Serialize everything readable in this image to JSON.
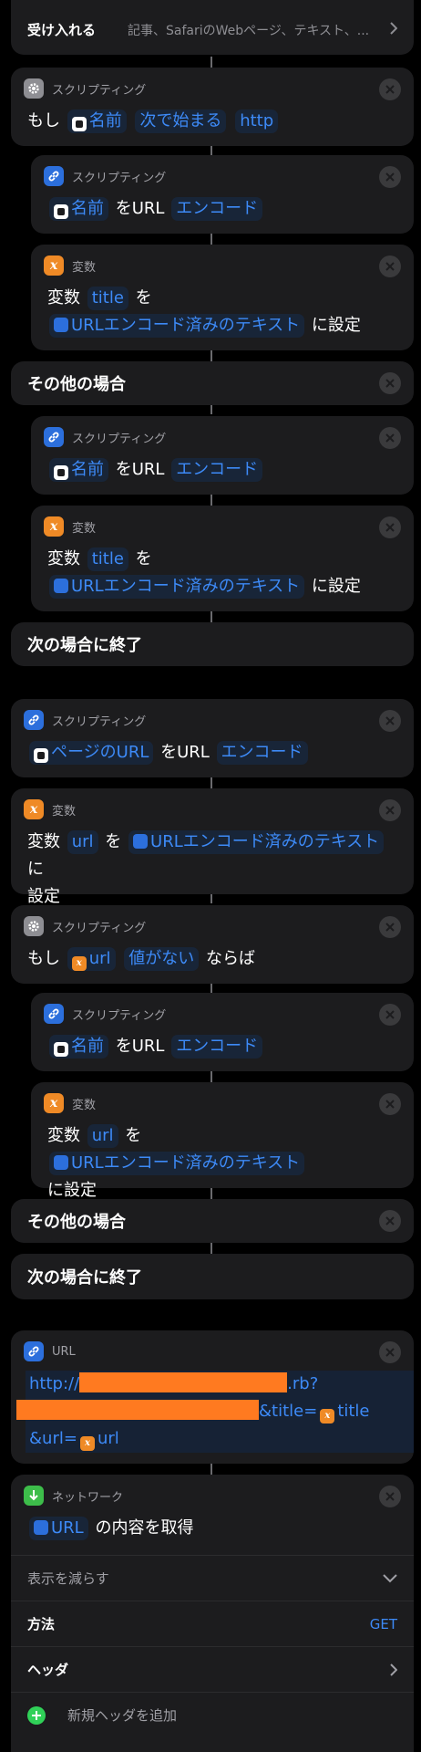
{
  "accept": {
    "label": "受け入れる",
    "value": "記事、SafariのWebページ、テキスト、..."
  },
  "cat_script": "スクリプティング",
  "cat_var": "変数",
  "cat_url": "URL",
  "cat_network": "ネットワーク",
  "if1": {
    "if": "もし",
    "name": "名前",
    "cond": "次で始まる",
    "value": "http"
  },
  "encode": {
    "text": "をURL",
    "mode": "エンコード"
  },
  "setvar": {
    "pre": "変数",
    "wo": "を",
    "encoded": "URLエンコード済みのテキスト",
    "set": "に設定",
    "ni": "に",
    "settei": "設定"
  },
  "var_title": "title",
  "var_url": "url",
  "otherwise": "その他の場合",
  "endif": "次の場合に終了",
  "page_url": "ページのURL",
  "if2": {
    "if": "もし",
    "cond": "値がない",
    "then": "ならば"
  },
  "url_block": {
    "prefix": "http://",
    "mid": ".rb?",
    "title_param": "&title=",
    "url_param": "&url="
  },
  "network": {
    "url_token": "URL",
    "action": "の内容を取得",
    "show_less": "表示を減らす",
    "method_label": "方法",
    "method_value": "GET",
    "headers_label": "ヘッダ",
    "add_header": "新規ヘッダを追加"
  }
}
